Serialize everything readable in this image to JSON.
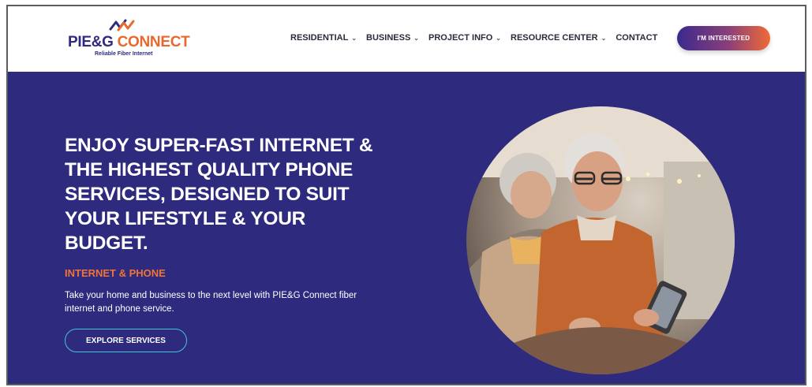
{
  "brand": {
    "name_part1": "PIE&G",
    "name_part2": "CONNECT",
    "tagline": "Reliable Fiber Internet",
    "colors": {
      "navy": "#2e2a7e",
      "orange": "#e8682e",
      "teal": "#47c3d6"
    }
  },
  "nav": {
    "items": [
      {
        "label": "RESIDENTIAL",
        "has_dropdown": true
      },
      {
        "label": "BUSINESS",
        "has_dropdown": true
      },
      {
        "label": "PROJECT INFO",
        "has_dropdown": true
      },
      {
        "label": "RESOURCE CENTER",
        "has_dropdown": true
      },
      {
        "label": "CONTACT",
        "has_dropdown": false
      }
    ],
    "dropdown_icon": "chevron-down-icon",
    "cta_label": "I'M INTERESTED"
  },
  "hero": {
    "title": "ENJOY SUPER-FAST INTERNET & THE HIGHEST QUALITY PHONE SERVICES, DESIGNED TO SUIT YOUR LIFESTYLE & YOUR BUDGET.",
    "subtitle": "INTERNET & PHONE",
    "description": "Take your home and business to the next level with PIE&G Connect fiber internet and phone service.",
    "button_label": "EXPLORE SERVICES",
    "image_icon": "couple-with-tablet-photo"
  }
}
